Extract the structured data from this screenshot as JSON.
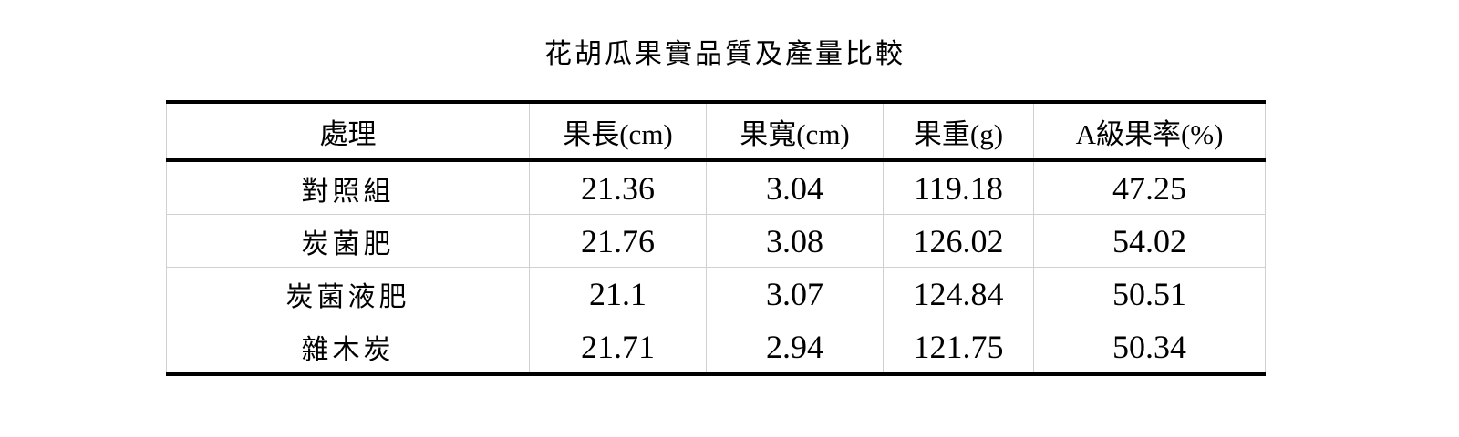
{
  "title": "花胡瓜果實品質及產量比較",
  "headers": [
    "處理",
    "果長(cm)",
    "果寬(cm)",
    "果重(g)",
    "A級果率(%)"
  ],
  "rows": [
    [
      "對照組",
      "21.36",
      "3.04",
      "119.18",
      "47.25"
    ],
    [
      "炭菌肥",
      "21.76",
      "3.08",
      "126.02",
      "54.02"
    ],
    [
      "炭菌液肥",
      "21.1",
      "3.07",
      "124.84",
      "50.51"
    ],
    [
      "雜木炭",
      "21.71",
      "2.94",
      "121.75",
      "50.34"
    ]
  ]
}
